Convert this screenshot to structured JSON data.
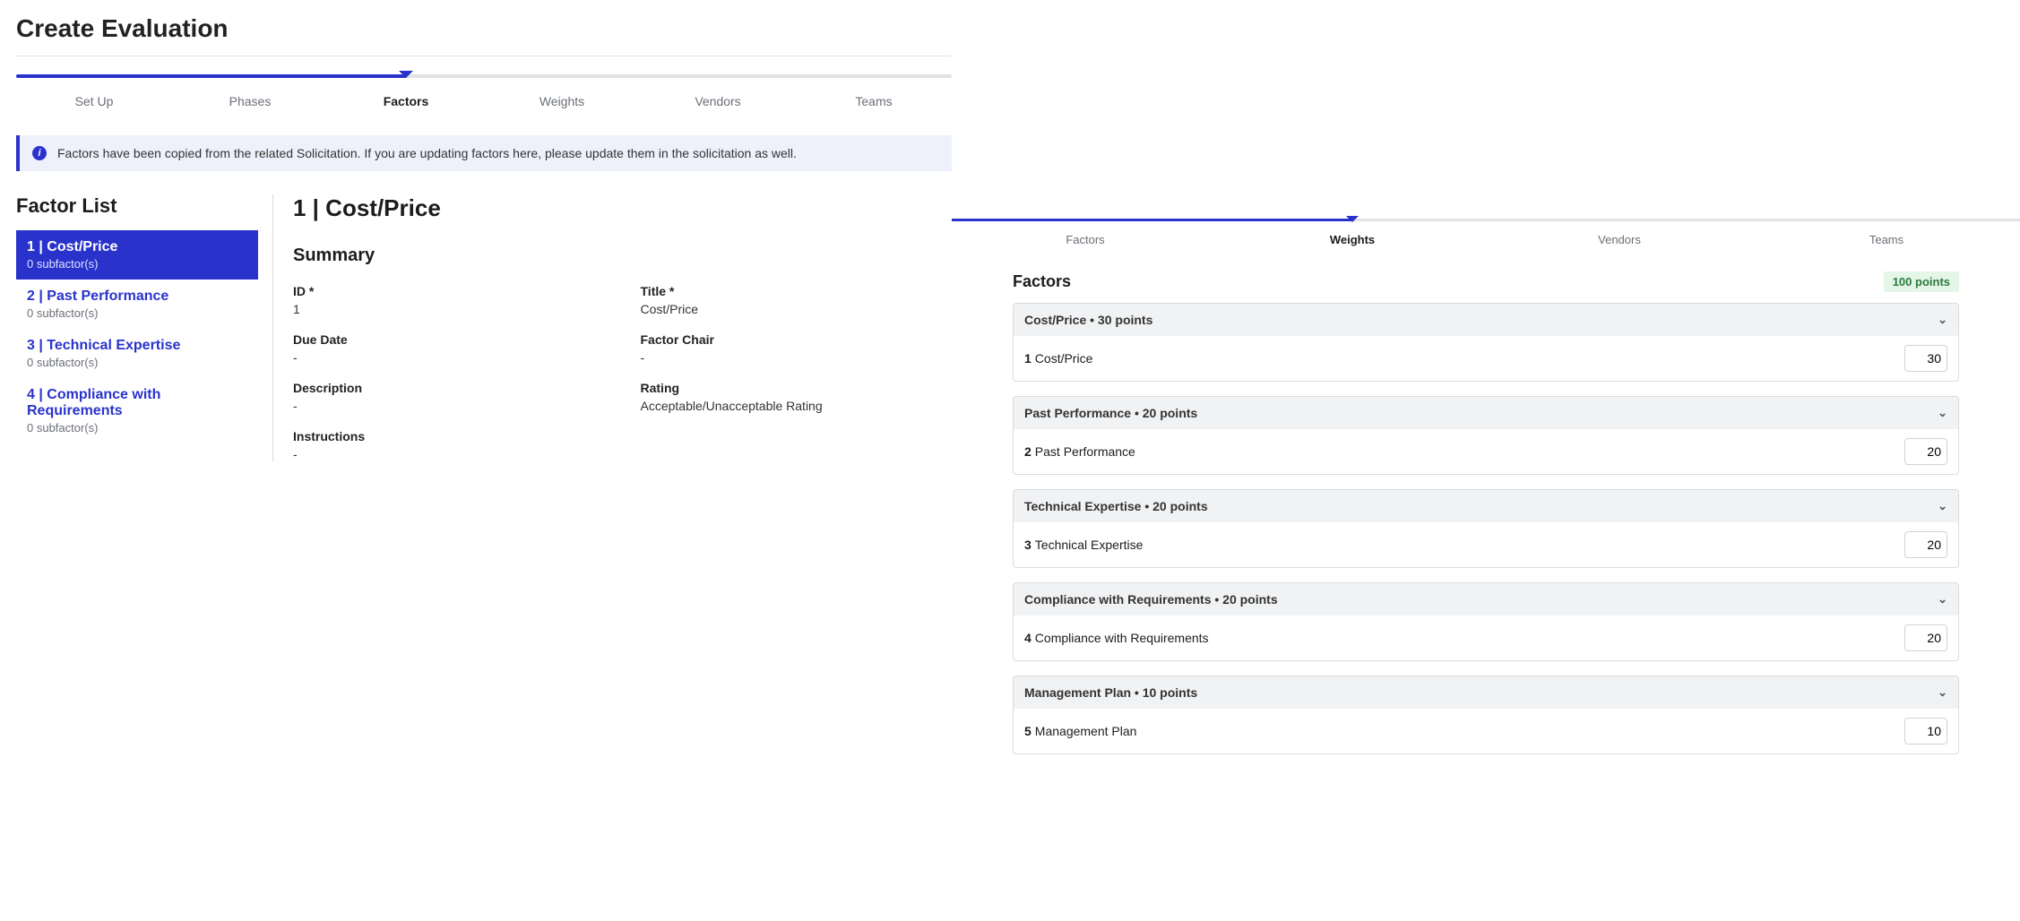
{
  "page_title": "Create Evaluation",
  "left_steps": {
    "items": [
      "Set Up",
      "Phases",
      "Factors",
      "Weights",
      "Vendors",
      "Teams"
    ],
    "active_index": 2
  },
  "info_banner": "Factors have been copied from the related Solicitation. If you are updating factors here, please update them in the solicitation as well.",
  "factor_list_title": "Factor List",
  "factor_list": [
    {
      "title": "1 | Cost/Price",
      "sub": "0  subfactor(s)",
      "selected": true
    },
    {
      "title": "2 | Past Performance",
      "sub": "0  subfactor(s)",
      "selected": false
    },
    {
      "title": "3 | Technical Expertise",
      "sub": "0  subfactor(s)",
      "selected": false
    },
    {
      "title": "4 | Compliance with Requirements",
      "sub": "0  subfactor(s)",
      "selected": false
    }
  ],
  "detail": {
    "heading": "1 | Cost/Price",
    "summary_label": "Summary",
    "fields": {
      "id_label": "ID *",
      "id_value": "1",
      "title_label": "Title *",
      "title_value": "Cost/Price",
      "due_date_label": "Due Date",
      "due_date_value": "-",
      "factor_chair_label": "Factor Chair",
      "factor_chair_value": "-",
      "description_label": "Description",
      "description_value": "-",
      "rating_label": "Rating",
      "rating_value": "Acceptable/Unacceptable Rating",
      "instructions_label": "Instructions",
      "instructions_value": "-"
    }
  },
  "right_steps": {
    "items": [
      "Factors",
      "Weights",
      "Vendors",
      "Teams"
    ],
    "active_index": 1
  },
  "weights_panel": {
    "title": "Factors",
    "total_points": "100 points",
    "groups": [
      {
        "header": "Cost/Price • 30 points",
        "num": "1",
        "name": "Cost/Price",
        "value": "30"
      },
      {
        "header": "Past Performance • 20 points",
        "num": "2",
        "name": "Past Performance",
        "value": "20"
      },
      {
        "header": "Technical Expertise • 20 points",
        "num": "3",
        "name": "Technical Expertise",
        "value": "20"
      },
      {
        "header": "Compliance with Requirements • 20 points",
        "num": "4",
        "name": "Compliance with Requirements",
        "value": "20"
      },
      {
        "header": "Management Plan • 10 points",
        "num": "5",
        "name": "Management Plan",
        "value": "10"
      }
    ]
  }
}
